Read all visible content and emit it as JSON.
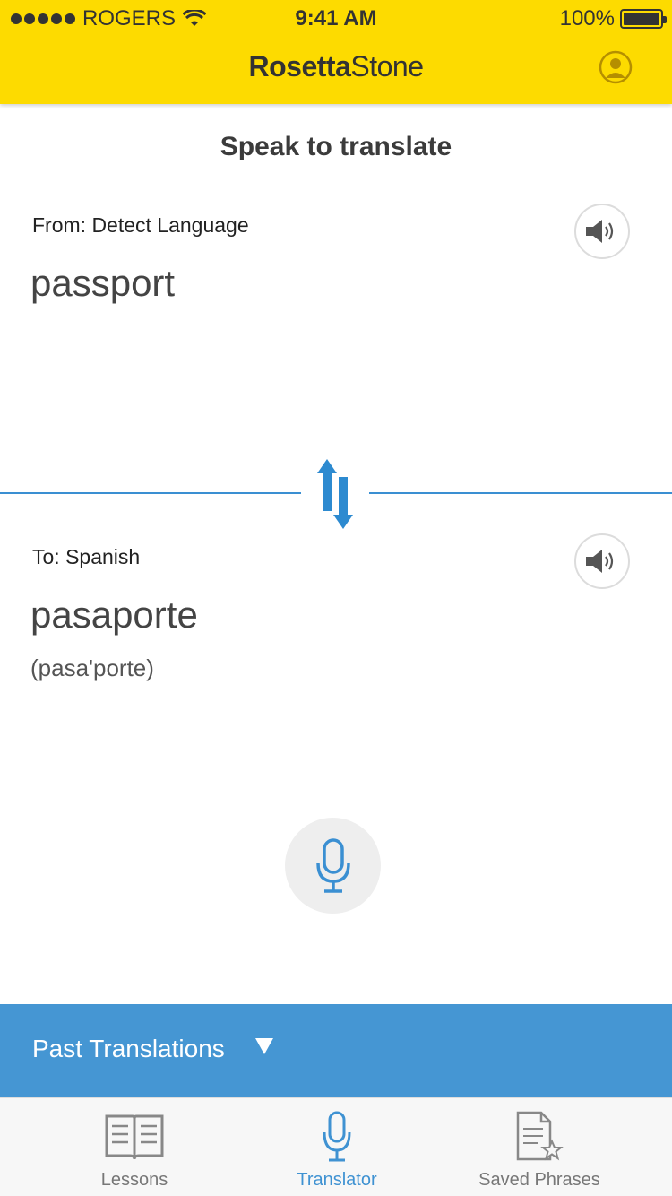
{
  "status_bar": {
    "carrier": "ROGERS",
    "time": "9:41 AM",
    "battery": "100%",
    "battery_level": 1.0
  },
  "header": {
    "brand_part1": "Rosetta",
    "brand_part2": "Stone",
    "profile_icon": "user-circle-icon",
    "color": "#FDDB00"
  },
  "main": {
    "title": "Speak to translate",
    "from": {
      "label": "From: Detect Language",
      "text": "passport"
    },
    "to": {
      "label": "To: Spanish",
      "text": "pasaporte",
      "phonetic": "(pasa'porte)"
    },
    "swap_icon": "swap-arrows-icon",
    "mic_icon": "microphone-icon",
    "accent_color": "#3a8fd2"
  },
  "past_translations": {
    "label": "Past Translations",
    "color": "#4596d3"
  },
  "tabs": [
    {
      "label": "Lessons",
      "icon": "book-icon",
      "active": false
    },
    {
      "label": "Translator",
      "icon": "microphone-icon",
      "active": true
    },
    {
      "label": "Saved Phrases",
      "icon": "document-star-icon",
      "active": false
    }
  ]
}
